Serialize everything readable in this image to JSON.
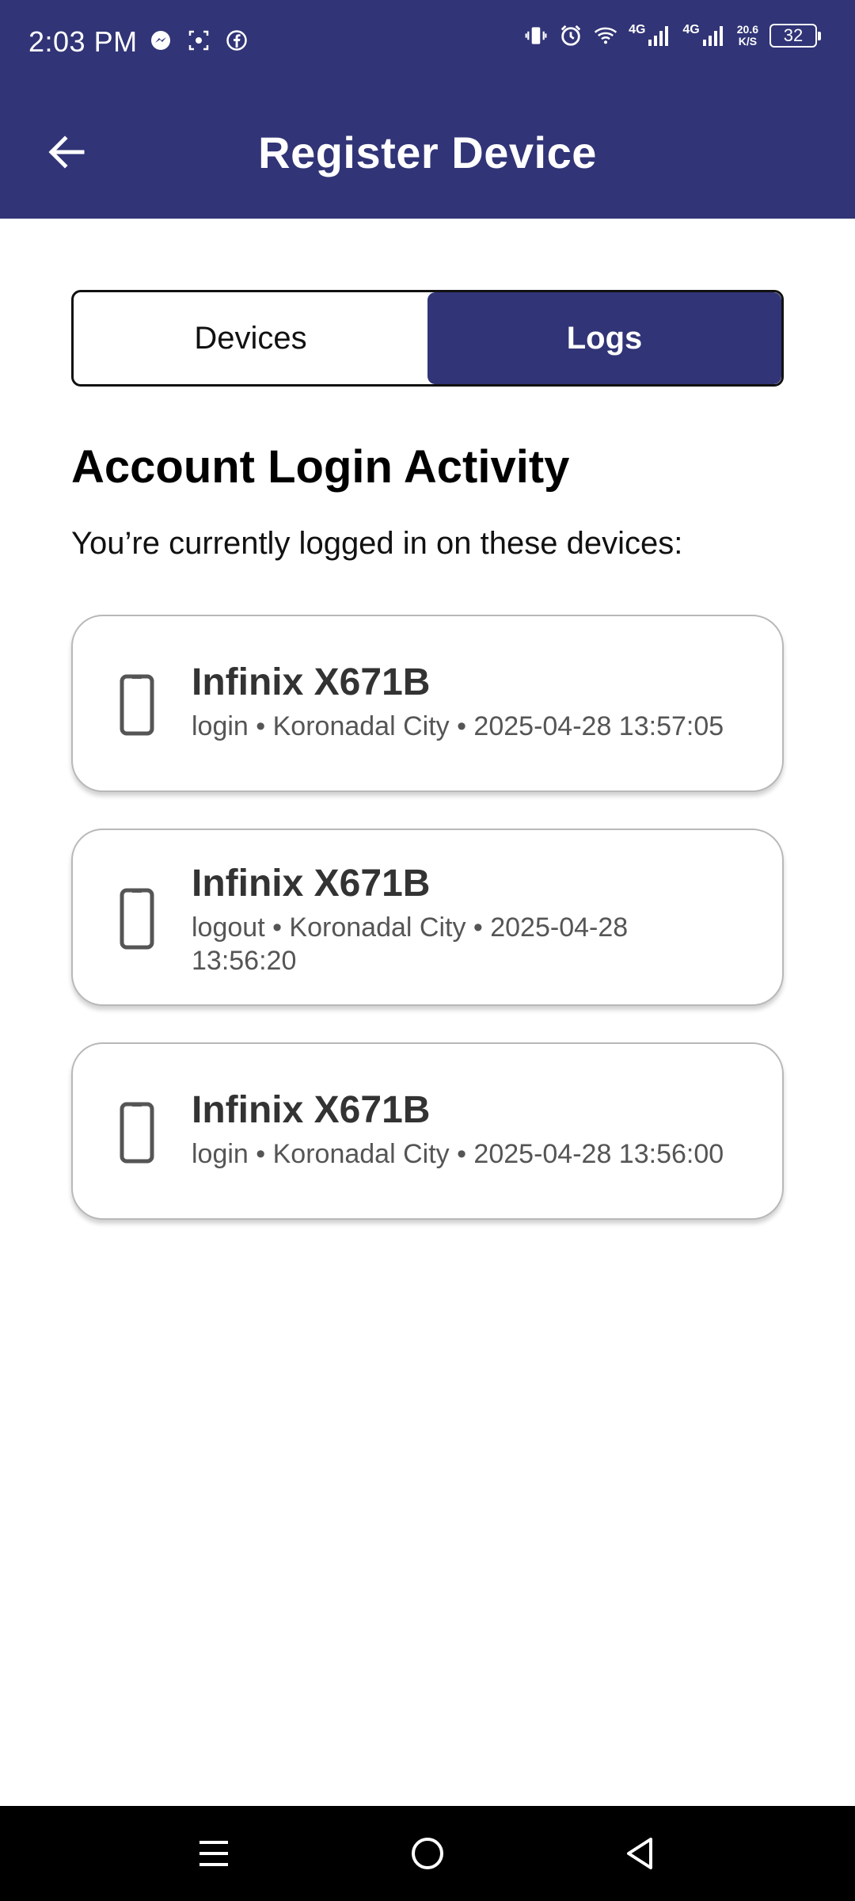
{
  "status_bar": {
    "time": "2:03 PM",
    "net1": "4G",
    "net2": "4G",
    "speed_value": "20.6",
    "speed_unit": "K/S",
    "battery": "32",
    "left_icons": [
      "messenger-icon",
      "screenshot-icon",
      "facebook-icon"
    ],
    "right_icons": [
      "vibrate-icon",
      "alarm-icon",
      "wifi-icon",
      "signal-icon",
      "signal-icon"
    ]
  },
  "app_bar": {
    "title": "Register Device",
    "back_icon": "arrow-left-icon"
  },
  "tabs": [
    {
      "label": "Devices",
      "active": false
    },
    {
      "label": "Logs",
      "active": true
    }
  ],
  "section": {
    "title": "Account Login Activity",
    "subtitle": "You’re currently logged in on these devices:"
  },
  "devices": [
    {
      "name": "Infinix X671B",
      "meta": "login • Koronadal City • 2025-04-28 13:57:05",
      "icon": "phone-icon"
    },
    {
      "name": "Infinix X671B",
      "meta": "logout • Koronadal City • 2025-04-28 13:56:20",
      "icon": "phone-icon"
    },
    {
      "name": "Infinix X671B",
      "meta": "login • Koronadal City • 2025-04-28 13:56:00",
      "icon": "phone-icon"
    }
  ],
  "nav_bar": {
    "items": [
      "menu-icon",
      "home-icon",
      "back-triangle-icon"
    ]
  },
  "colors": {
    "primary": "#313476",
    "text_dark": "#333333",
    "text_meta": "#555555",
    "card_border": "#b8b8b8"
  }
}
